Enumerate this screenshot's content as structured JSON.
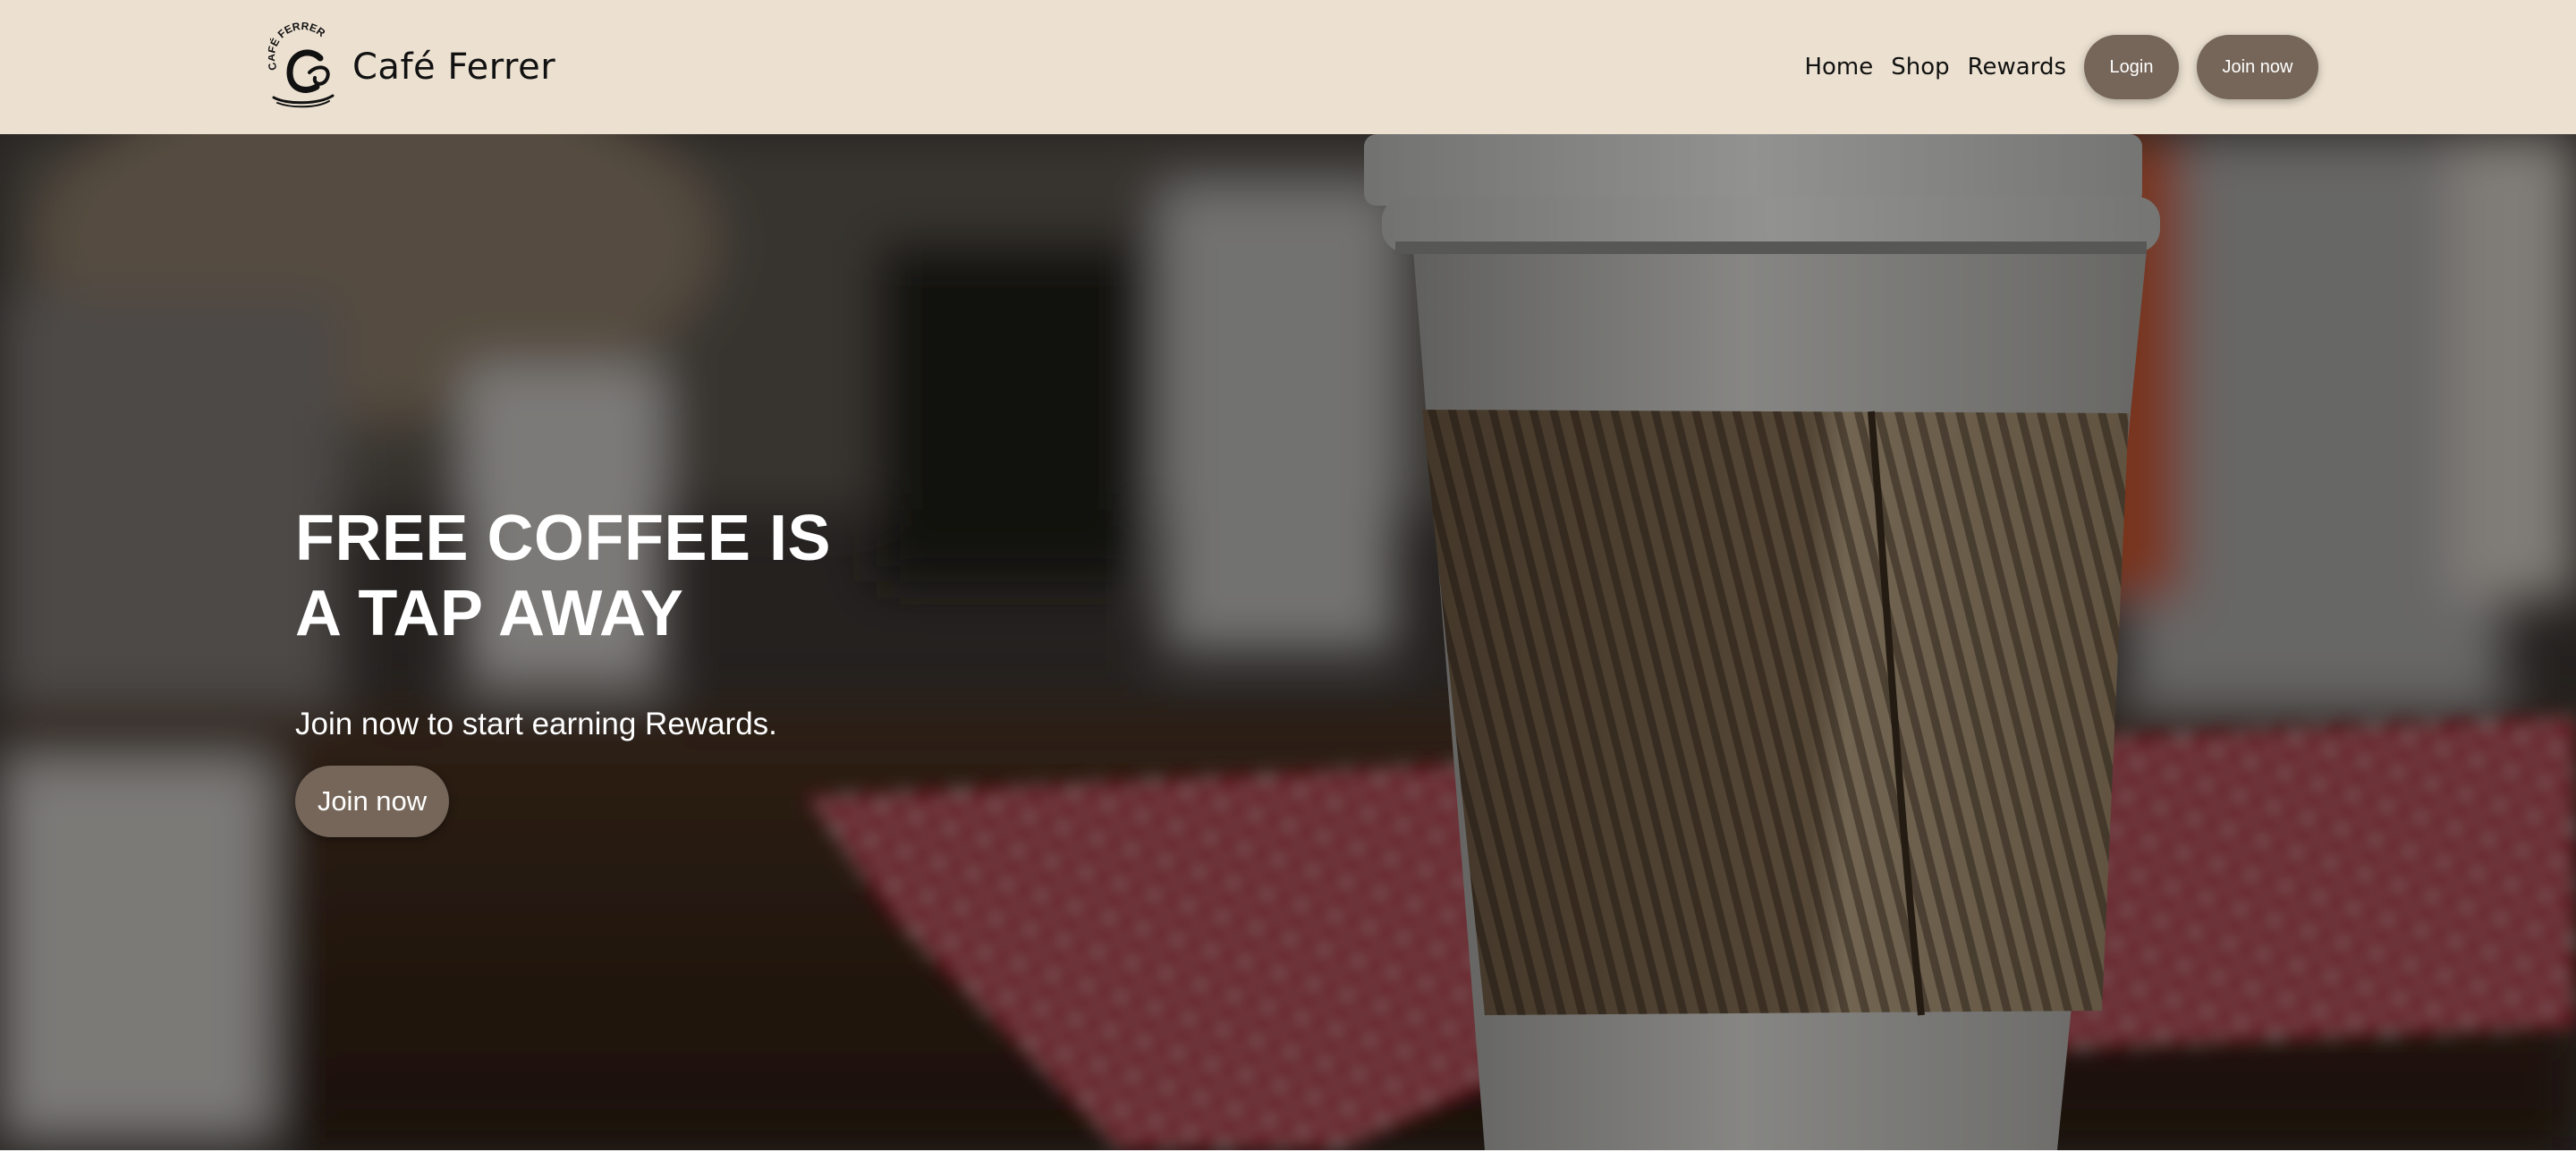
{
  "brand": {
    "name": "Café Ferrer",
    "logo_text": "CAFÉ FERRER",
    "logo_icon": "coffee-cup-monogram-icon"
  },
  "nav": {
    "links": [
      "Home",
      "Shop",
      "Rewards"
    ],
    "login_label": "Login",
    "join_label": "Join now"
  },
  "hero": {
    "title_line1": "FREE COFFEE IS",
    "title_line2": "A TAP AWAY",
    "subtitle": "Join now to start earning Rewards.",
    "cta_label": "Join now",
    "background": "blurred-cafe-table-with-paper-coffee-cup-photo"
  },
  "colors": {
    "header_bg": "#ece1d1",
    "button_bg": "#756659",
    "text_dark": "#111111",
    "text_light": "#ffffff"
  }
}
